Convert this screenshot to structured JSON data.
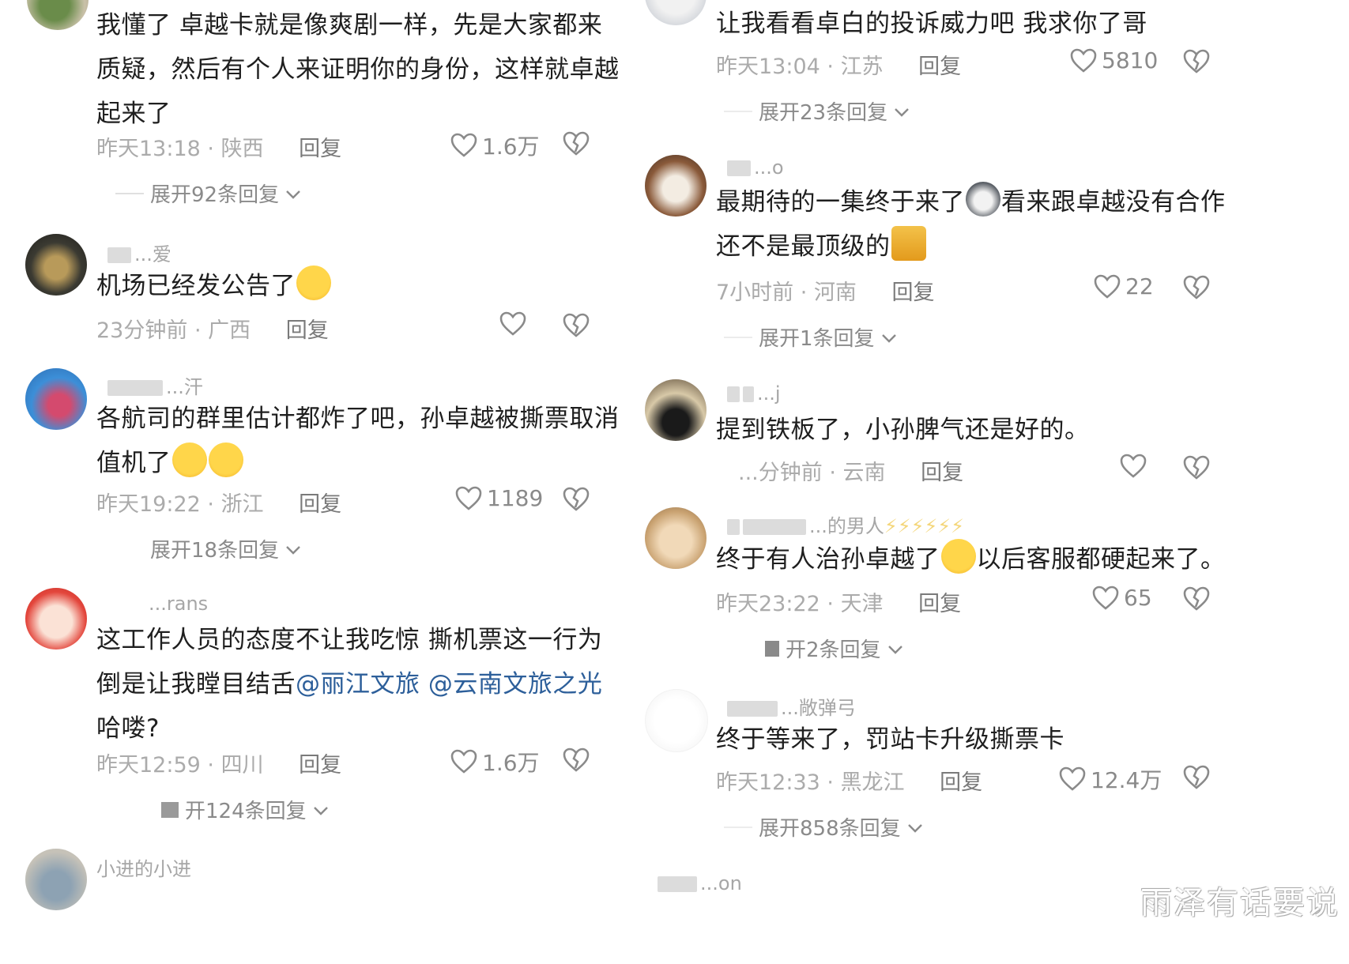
{
  "left": [
    {
      "body": [
        "我懂了 卓越卡就是像爽剧一样，先是大家都来",
        "质疑，然后有个人来证明你的身份，这样就卓越",
        "起来了"
      ],
      "time": "昨天13:18",
      "region": "陕西",
      "reply": "回复",
      "likes": "1.6万",
      "expand": "展开92条回复"
    },
    {
      "username": "...爱",
      "body_text": "机场已经发公告了",
      "time": "23分钟前",
      "region": "广西",
      "reply": "回复",
      "likes": "",
      "expand": ""
    },
    {
      "username": "...汗",
      "body": [
        "各航司的群里估计都炸了吧，孙卓越被撕票取消",
        "值机了"
      ],
      "time": "昨天19:22",
      "region": "浙江",
      "reply": "回复",
      "likes": "1189",
      "expand": "展开18条回复"
    },
    {
      "username": "...rans",
      "body_line1": "这工作人员的态度不让我吃惊 撕机票这一行为",
      "body_line2": "倒是让我瞠目结舌",
      "mention1": "@丽江文旅",
      "mention2": "@云南文旅之光",
      "body_line3": "哈喽?",
      "time": "昨天12:59",
      "region": "四川",
      "reply": "回复",
      "likes": "1.6万",
      "expand": "开124条回复"
    },
    {
      "username": "小进的小进"
    }
  ],
  "right": [
    {
      "body_text": "让我看看卓白的投诉威力吧 我求你了哥",
      "time": "昨天13:04",
      "region": "江苏",
      "reply": "回复",
      "likes": "5810",
      "expand": "展开23条回复"
    },
    {
      "username": "...o",
      "body_line1a": "最期待的一集终于来了",
      "body_line1b": "看来跟卓越没有合作",
      "body_line2": "还不是最顶级的",
      "time": "7小时前",
      "region": "河南",
      "reply": "回复",
      "likes": "22",
      "expand": "展开1条回复"
    },
    {
      "username": "...j",
      "body_text": "提到铁板了，小孙脾气还是好的。",
      "time": "...分钟前",
      "region": "云南",
      "reply": "回复",
      "likes": "",
      "expand": ""
    },
    {
      "username": "...的男人",
      "username_emoji": "⚡⚡⚡⚡⚡⚡",
      "body_a": "终于有人治孙卓越了",
      "body_b": "以后客服都硬起来了。",
      "time": "昨天23:22",
      "region": "天津",
      "reply": "回复",
      "likes": "65",
      "expand": "开2条回复"
    },
    {
      "username": "...敞弹弓",
      "body_text": "终于等来了，罚站卡升级撕票卡",
      "time": "昨天12:33",
      "region": "黑龙江",
      "reply": "回复",
      "likes": "12.4万",
      "expand": "展开858条回复"
    },
    {
      "username": "...on"
    }
  ],
  "watermark": "雨泽有话要说"
}
